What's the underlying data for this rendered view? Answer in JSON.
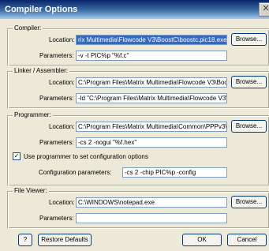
{
  "window": {
    "title": "Compiler Options",
    "close_glyph": "✕"
  },
  "compiler": {
    "group_label": "Compiler:",
    "location_label": "Location:",
    "location_value": "rix Multimedia\\Flowcode V3\\BoostC\\boostc.pic18.exe",
    "browse_label": "Browse...",
    "parameters_label": "Parameters:",
    "parameters_value": "-v -t PIC%p \"%f.c\""
  },
  "linker": {
    "group_label": "Linker / Assembler:",
    "location_label": "Location:",
    "location_value": "C:\\Program Files\\Matrix Multimedia\\Flowcode V3\\Boo",
    "browse_label": "Browse...",
    "parameters_label": "Parameters:",
    "parameters_value": "-ld \"C:\\Program Files\\Matrix Multimedia\\Flowcode V3\\"
  },
  "programmer": {
    "group_label": "Programmer:",
    "location_label": "Location:",
    "location_value": "C:\\Program Files\\Matrix Multimedia\\Common\\PPPv3\\",
    "browse_label": "Browse...",
    "parameters_label": "Parameters:",
    "parameters_value": "-cs 2 -nogui \"%f.hex\"",
    "use_config_checked": true,
    "use_config_label": "Use programmer to set configuration options",
    "config_params_label": "Configuration parameters:",
    "config_params_value": "-cs 2 -chip PIC%p -config"
  },
  "file_viewer": {
    "group_label": "File Viewer:",
    "location_label": "Location:",
    "location_value": "C:\\WINDOWS\\notepad.exe",
    "browse_label": "Browse...",
    "parameters_label": "Parameters:",
    "parameters_value": ""
  },
  "footer": {
    "help_label": "?",
    "restore_label": "Restore Defaults",
    "ok_label": "OK",
    "cancel_label": "Cancel"
  },
  "icons": {
    "close": "close-icon",
    "checkbox_checkmark": "checkmark-icon"
  }
}
